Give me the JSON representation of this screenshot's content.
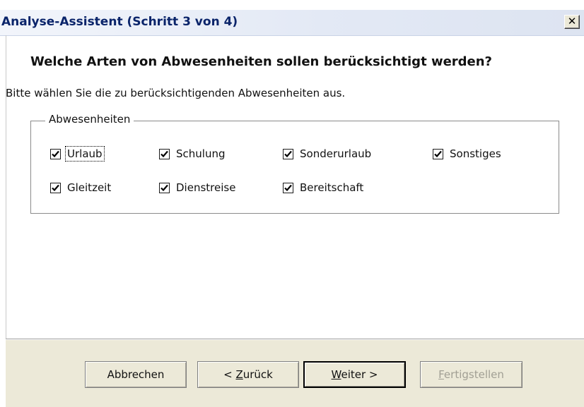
{
  "window": {
    "title": "Analyse-Assistent (Schritt 3 von 4)",
    "close_glyph": "✕"
  },
  "content": {
    "heading": "Welche Arten von Abwesenheiten sollen berücksichtigt werden?",
    "instruction": "Bitte wählen Sie die zu berücksichtigenden Abwesenheiten aus."
  },
  "group": {
    "legend": "Abwesenheiten",
    "items": [
      {
        "label": "Urlaub",
        "checked": true,
        "focused": true
      },
      {
        "label": "Schulung",
        "checked": true
      },
      {
        "label": "Sonderurlaub",
        "checked": true
      },
      {
        "label": "Sonstiges",
        "checked": true
      },
      {
        "label": "Gleitzeit",
        "checked": true
      },
      {
        "label": "Dienstreise",
        "checked": true
      },
      {
        "label": "Bereitschaft",
        "checked": true
      }
    ]
  },
  "buttons": {
    "cancel": "Abbrechen",
    "back_prefix": "< ",
    "back_mnemonic": "Z",
    "back_rest": "urück",
    "next_mnemonic": "W",
    "next_rest": "eiter >",
    "finish_mnemonic": "F",
    "finish_rest": "ertigstellen"
  },
  "colors": {
    "title_text": "#0a246a",
    "button_face": "#ece9d8",
    "disabled_text": "#a19f94"
  }
}
